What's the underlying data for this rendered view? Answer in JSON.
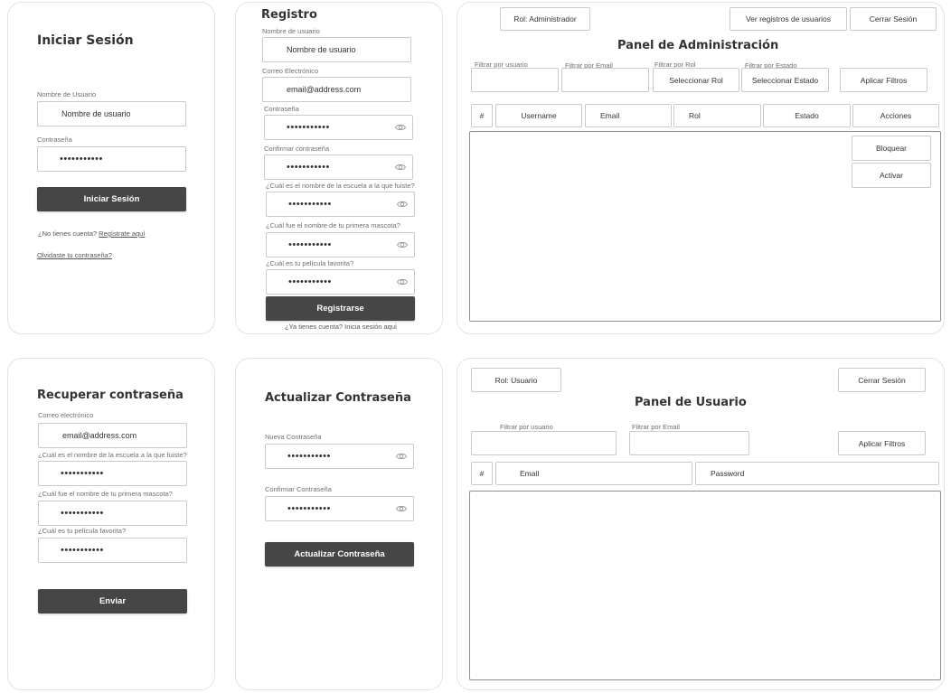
{
  "login": {
    "title": "Iniciar Sesión",
    "username_label": "Nombre de Usuario",
    "username_value": "Nombre de usuario",
    "password_label": "Contraseña",
    "password_value": "•••••••••••",
    "submit": "Iniciar Sesión",
    "no_account": "¿No tienes cuenta?",
    "register_link": "Regístrate aquí",
    "forgot_link": "Olvidaste tu contraseña?"
  },
  "register": {
    "title": "Registro",
    "username_label": "Nombre de usuario",
    "username_value": "Nombre de usuario",
    "email_label": "Correo Electrónico",
    "email_value": "email@address.com",
    "password_label": "Contraseña",
    "password_value": "•••••••••••",
    "confirm_label": "Confirmar contraseña",
    "confirm_value": "•••••••••••",
    "q1_label": "¿Cuál es el nombre de la escuela a la que fuiste?",
    "q1_value": "•••••••••••",
    "q2_label": "¿Cuál fue el nombre de tu primera mascota?",
    "q2_value": "•••••••••••",
    "q3_label": "¿Cuál es tu película favorita?",
    "q3_value": "•••••••••••",
    "submit": "Registrarse",
    "has_account": "¿Ya tienes cuenta? Inicia sesión aquí"
  },
  "admin": {
    "role": "Rol: Administrador",
    "view_logs": "Ver registros de usuarios",
    "logout": "Cerrar Sesión",
    "title": "Panel de Administración",
    "filter_user_label": "Filtrar por usuario",
    "filter_email_label": "Filtrar por Email",
    "filter_role_label": "Filtrar por Rol",
    "filter_role_value": "Seleccionar Rol",
    "filter_state_label": "Filtrar por Estado",
    "filter_state_value": "Seleccionar Estado",
    "apply": "Aplicar Filtros",
    "columns": [
      "#",
      "Username",
      "Email",
      "Rol",
      "Estado",
      "Acciones"
    ],
    "block": "Bloquear",
    "activate": "Activar"
  },
  "recover": {
    "title": "Recuperar contraseña",
    "email_label": "Correo electrónico",
    "email_value": "email@address.com",
    "q1_label": "¿Cuál es el nombre de la escuela a la que fuiste?",
    "q1_value": "•••••••••••",
    "q2_label": "¿Cuál fue el nombre de tu primera mascota?",
    "q2_value": "•••••••••••",
    "q3_label": "¿Cuál es tu película favorita?",
    "q3_value": "•••••••••••",
    "submit": "Enviar"
  },
  "update": {
    "title": "Actualizar Contraseña",
    "new_label": "Nueva Contraseña",
    "new_value": "•••••••••••",
    "confirm_label": "Confirmar Contraseña",
    "confirm_value": "•••••••••••",
    "submit": "Actualizar Contraseña"
  },
  "user": {
    "role": "Rol: Usuario",
    "logout": "Cerrar Sesión",
    "title": "Panel de Usuario",
    "filter_user_label": "Filtrar por usuario",
    "filter_email_label": "Filtrar por Email",
    "apply": "Aplicar Filtros",
    "columns": [
      "#",
      "Email",
      "Password"
    ]
  },
  "icons": {
    "eye": "eye-icon"
  },
  "colors": {
    "primary_button": "#464646",
    "border": "#c9c9c9",
    "panel_border": "#e3e3e3"
  }
}
